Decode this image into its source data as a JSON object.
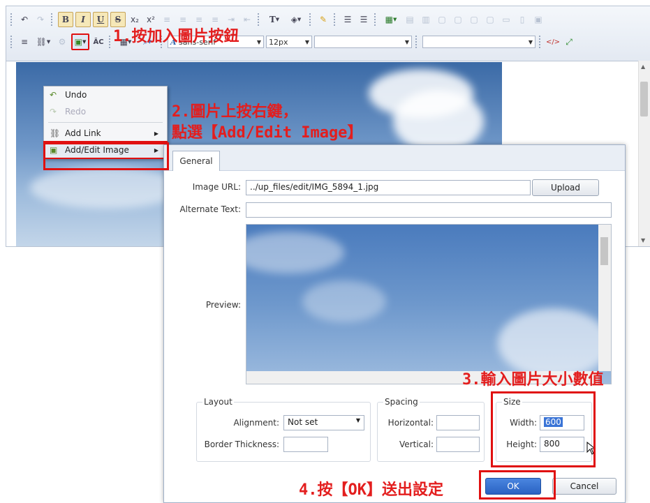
{
  "toolbar": {
    "font_name": "sans-serif",
    "font_size": "12px",
    "format_buttons": [
      "B",
      "I",
      "U",
      "S"
    ],
    "text_color_label": "T",
    "special_char_label": "ÃC"
  },
  "context_menu": {
    "items": [
      {
        "label": "Undo",
        "icon": "undo-icon",
        "disabled": false
      },
      {
        "label": "Redo",
        "icon": "redo-icon",
        "disabled": true
      },
      {
        "label": "Add Link",
        "icon": "link-icon",
        "disabled": false
      },
      {
        "label": "Add/Edit Image",
        "icon": "image-icon",
        "disabled": false
      }
    ]
  },
  "dialog": {
    "tab": "General",
    "image_url_label": "Image URL:",
    "image_url_value": "../up_files/edit/IMG_5894_1.jpg",
    "upload_label": "Upload",
    "alt_text_label": "Alternate Text:",
    "preview_label": "Preview:",
    "layout": {
      "legend": "Layout",
      "alignment_label": "Alignment:",
      "alignment_value": "Not set",
      "border_label": "Border Thickness:"
    },
    "spacing": {
      "legend": "Spacing",
      "horizontal_label": "Horizontal:",
      "vertical_label": "Vertical:"
    },
    "size": {
      "legend": "Size",
      "width_label": "Width:",
      "width_value": "600",
      "height_label": "Height:",
      "height_value": "800"
    },
    "ok_label": "OK",
    "cancel_label": "Cancel"
  },
  "annotations": {
    "step1": "1.按加入圖片按鈕",
    "step2_line1": "2.圖片上按右鍵，",
    "step2_line2": "點選【Add/Edit Image】",
    "step3": "3.輸入圖片大小數值",
    "step4": "4.按【OK】送出設定"
  },
  "colors": {
    "annotation_red": "#e31e1e",
    "highlight_box": "#e01010",
    "ok_button": "#2f6fd0"
  }
}
